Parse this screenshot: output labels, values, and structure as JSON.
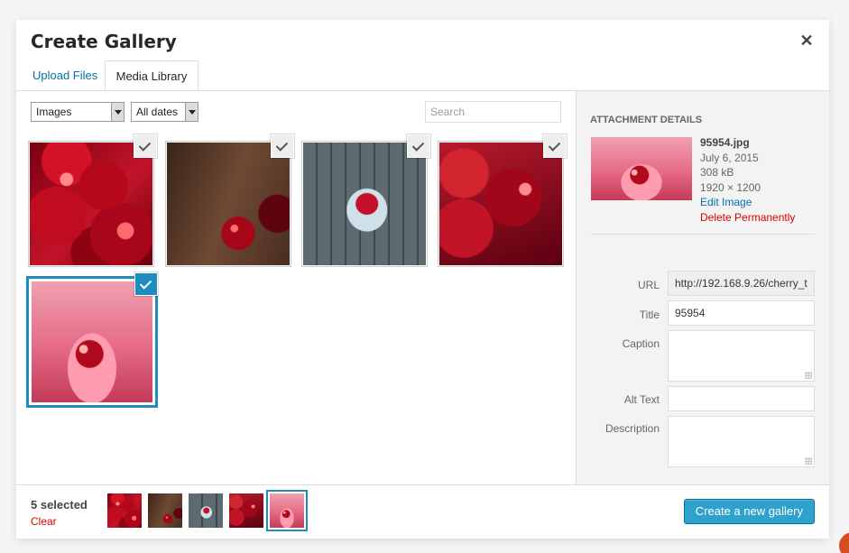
{
  "modal": {
    "title": "Create Gallery",
    "close_icon": "close-icon",
    "tabs": [
      {
        "label": "Upload Files",
        "active": false
      },
      {
        "label": "Media Library",
        "active": true
      }
    ]
  },
  "toolbar": {
    "type_filter": "Images",
    "date_filter": "All dates",
    "search_placeholder": "Search"
  },
  "library": {
    "items": [
      {
        "image": "cherries-heap",
        "selected": true
      },
      {
        "image": "cherry-pair-brown",
        "selected": true
      },
      {
        "image": "cherry-bowl-wood",
        "selected": true
      },
      {
        "image": "cherries-closeup",
        "selected": true
      },
      {
        "image": "cherry-splash-pink",
        "selected": true,
        "active": true
      }
    ]
  },
  "details": {
    "heading": "Attachment Details",
    "filename": "95954.jpg",
    "date": "July 6, 2015",
    "size": "308 kB",
    "dimensions": "1920 × 1200",
    "edit_link": "Edit Image",
    "delete_link": "Delete Permanently",
    "fields": {
      "url_label": "URL",
      "url_value": "http://192.168.9.26/cherry_t",
      "title_label": "Title",
      "title_value": "95954",
      "caption_label": "Caption",
      "caption_value": "",
      "alt_label": "Alt Text",
      "alt_value": "",
      "description_label": "Description",
      "description_value": ""
    }
  },
  "footer": {
    "selected_count": "5 selected",
    "clear_label": "Clear",
    "create_button": "Create a new gallery"
  },
  "colors": {
    "accent": "#1e8cbe",
    "link": "#0073aa",
    "danger": "#dd0000",
    "primary_button": "#2ea2cc"
  }
}
